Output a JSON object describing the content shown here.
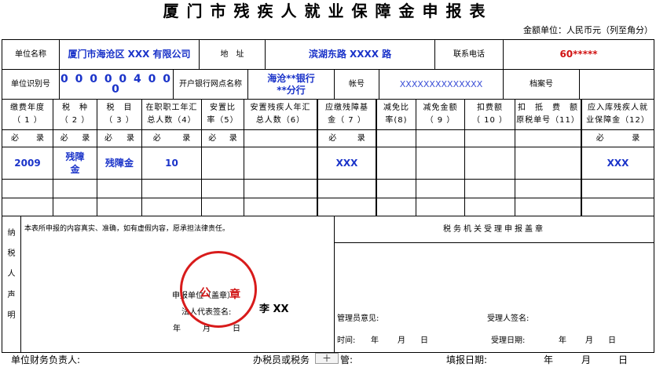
{
  "title": "厦门市残疾人就业保障金申报表",
  "unit_note": "金额单位：人民币元（列至角分）",
  "info_row1": {
    "name_label": "单位名称",
    "name_value": "厦门市海沧区 XXX 有限公司",
    "address_label": "地　址",
    "address_value": "滨湖东路 XXXX 路",
    "phone_label": "联系电话",
    "phone_value": "60*****"
  },
  "info_row2": {
    "id_label": "单位识别号",
    "id_value": "0 0 0 0 0 4 0 0 0",
    "bank_label": "开户银行网点名称",
    "bank_value": "海沧**银行\n**分行",
    "account_label": "帐号",
    "account_value": "XXXXXXXXXXXXXX",
    "archive_label": "档案号",
    "archive_value": ""
  },
  "columns": [
    "缴费年度\n（ 1 ）",
    "税　种\n（ 2 ）",
    "税　目\n（ 3 ）",
    "在职职工年汇\n总人数（4）",
    "安置比\n率（5）",
    "安置残疾人年汇\n总人数（6）",
    "应缴残障基\n金（ 7 ）",
    "减免比\n率(8)",
    "减免金额\n（ 9 ）",
    "扣费额\n（ 10 ）",
    "扣　抵　费　额\n原税单号（11）",
    "应入库残疾人就\n业保障金（12）"
  ],
  "must_fill": {
    "left": "必",
    "right": "录"
  },
  "data_row": {
    "year": "2009",
    "tax_type": "残障\n金",
    "tax_item": "残障金",
    "employees": "10",
    "fund_due": "XXX",
    "fund_payable": "XXX"
  },
  "declaration": {
    "side_label": [
      "纳",
      "税",
      "人",
      "声",
      "明"
    ],
    "statement": "本表所申报的内容真实、准确，如有虚假内容，愿承担法律责任。",
    "unit_label": "申报单位（盖章）",
    "rep_label": "法人代表签名:",
    "rep_value": "李 XX",
    "year": "年",
    "month": "月",
    "day": "日"
  },
  "seal": {
    "char1": "公",
    "char2": "章",
    "color": "#d81b1b"
  },
  "tax_office": {
    "header": "税务机关受理申报盖章",
    "manager_opinion": "管理员意见:",
    "acceptor_sign": "受理人签名:",
    "time_label": "时间:",
    "accept_date_label": "受理日期:",
    "year": "年",
    "month": "月",
    "day": "日"
  },
  "footer": {
    "finance_label": "单位财务负责人:",
    "agent_label": "办税员或税务",
    "agent_suffix": "管:",
    "plus": "＋",
    "date_label": "填报日期:",
    "year": "年",
    "month": "月",
    "day": "日"
  }
}
